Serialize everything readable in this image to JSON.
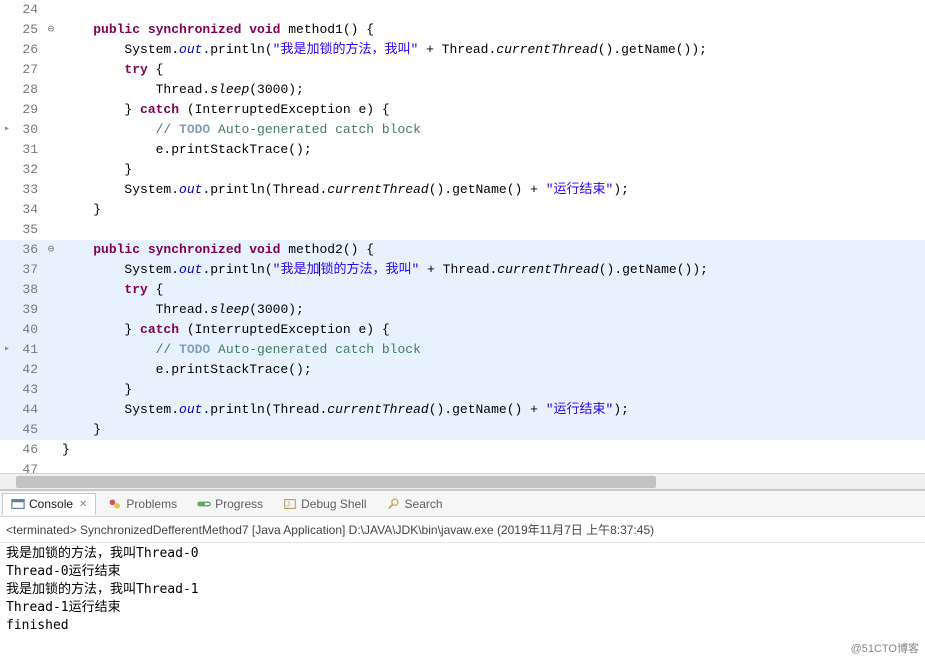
{
  "editor": {
    "lines": [
      {
        "num": 24,
        "anno": "",
        "fold": "",
        "tokens": []
      },
      {
        "num": 25,
        "anno": "",
        "fold": "⊖",
        "tokens": [
          {
            "t": "    ",
            "c": ""
          },
          {
            "t": "public synchronized void",
            "c": "kw"
          },
          {
            "t": " method1() {",
            "c": ""
          }
        ]
      },
      {
        "num": 26,
        "anno": "",
        "fold": "",
        "tokens": [
          {
            "t": "        System.",
            "c": ""
          },
          {
            "t": "out",
            "c": "field"
          },
          {
            "t": ".println(",
            "c": ""
          },
          {
            "t": "\"我是加锁的方法，我叫\"",
            "c": "str"
          },
          {
            "t": " + Thread.",
            "c": ""
          },
          {
            "t": "currentThread",
            "c": "mstatic"
          },
          {
            "t": "().getName());",
            "c": ""
          }
        ]
      },
      {
        "num": 27,
        "anno": "",
        "fold": "",
        "tokens": [
          {
            "t": "        ",
            "c": ""
          },
          {
            "t": "try",
            "c": "kw"
          },
          {
            "t": " {",
            "c": ""
          }
        ]
      },
      {
        "num": 28,
        "anno": "",
        "fold": "",
        "tokens": [
          {
            "t": "            Thread.",
            "c": ""
          },
          {
            "t": "sleep",
            "c": "mstatic"
          },
          {
            "t": "(3000);",
            "c": ""
          }
        ]
      },
      {
        "num": 29,
        "anno": "",
        "fold": "",
        "tokens": [
          {
            "t": "        } ",
            "c": ""
          },
          {
            "t": "catch",
            "c": "kw"
          },
          {
            "t": " (InterruptedException e) {",
            "c": ""
          }
        ]
      },
      {
        "num": 30,
        "anno": "▸",
        "fold": "",
        "tokens": [
          {
            "t": "            ",
            "c": ""
          },
          {
            "t": "// ",
            "c": "comm"
          },
          {
            "t": "TODO",
            "c": "todo"
          },
          {
            "t": " Auto-generated catch block",
            "c": "todo-txt"
          }
        ]
      },
      {
        "num": 31,
        "anno": "",
        "fold": "",
        "tokens": [
          {
            "t": "            e.printStackTrace();",
            "c": ""
          }
        ]
      },
      {
        "num": 32,
        "anno": "",
        "fold": "",
        "tokens": [
          {
            "t": "        }",
            "c": ""
          }
        ]
      },
      {
        "num": 33,
        "anno": "",
        "fold": "",
        "tokens": [
          {
            "t": "        System.",
            "c": ""
          },
          {
            "t": "out",
            "c": "field"
          },
          {
            "t": ".println(Thread.",
            "c": ""
          },
          {
            "t": "currentThread",
            "c": "mstatic"
          },
          {
            "t": "().getName() + ",
            "c": ""
          },
          {
            "t": "\"运行结束\"",
            "c": "str"
          },
          {
            "t": ");",
            "c": ""
          }
        ]
      },
      {
        "num": 34,
        "anno": "",
        "fold": "",
        "tokens": [
          {
            "t": "    }",
            "c": ""
          }
        ]
      },
      {
        "num": 35,
        "anno": "",
        "fold": "",
        "tokens": []
      },
      {
        "num": 36,
        "anno": "",
        "fold": "⊖",
        "hl": true,
        "tokens": [
          {
            "t": "    ",
            "c": ""
          },
          {
            "t": "public synchronized void",
            "c": "kw"
          },
          {
            "t": " method2() {",
            "c": ""
          }
        ]
      },
      {
        "num": 37,
        "anno": "",
        "fold": "",
        "hl": true,
        "cursor": true,
        "tokens": [
          {
            "t": "        System.",
            "c": ""
          },
          {
            "t": "out",
            "c": "field"
          },
          {
            "t": ".println(",
            "c": ""
          },
          {
            "t": "\"我是加",
            "c": "str"
          },
          {
            "t": "|",
            "c": "cursor-marker"
          },
          {
            "t": "锁的方法，我叫\"",
            "c": "str"
          },
          {
            "t": " + Thread.",
            "c": ""
          },
          {
            "t": "currentThread",
            "c": "mstatic"
          },
          {
            "t": "().getName());",
            "c": ""
          }
        ]
      },
      {
        "num": 38,
        "anno": "",
        "fold": "",
        "hl": true,
        "tokens": [
          {
            "t": "        ",
            "c": ""
          },
          {
            "t": "try",
            "c": "kw"
          },
          {
            "t": " {",
            "c": ""
          }
        ]
      },
      {
        "num": 39,
        "anno": "",
        "fold": "",
        "hl": true,
        "tokens": [
          {
            "t": "            Thread.",
            "c": ""
          },
          {
            "t": "sleep",
            "c": "mstatic"
          },
          {
            "t": "(3000);",
            "c": ""
          }
        ]
      },
      {
        "num": 40,
        "anno": "",
        "fold": "",
        "hl": true,
        "tokens": [
          {
            "t": "        } ",
            "c": ""
          },
          {
            "t": "catch",
            "c": "kw"
          },
          {
            "t": " (InterruptedException e) {",
            "c": ""
          }
        ]
      },
      {
        "num": 41,
        "anno": "▸",
        "fold": "",
        "hl": true,
        "tokens": [
          {
            "t": "            ",
            "c": ""
          },
          {
            "t": "// ",
            "c": "comm"
          },
          {
            "t": "TODO",
            "c": "todo"
          },
          {
            "t": " Auto-generated catch block",
            "c": "todo-txt"
          }
        ]
      },
      {
        "num": 42,
        "anno": "",
        "fold": "",
        "hl": true,
        "tokens": [
          {
            "t": "            e.printStackTrace();",
            "c": ""
          }
        ]
      },
      {
        "num": 43,
        "anno": "",
        "fold": "",
        "hl": true,
        "tokens": [
          {
            "t": "        }",
            "c": ""
          }
        ]
      },
      {
        "num": 44,
        "anno": "",
        "fold": "",
        "hl": true,
        "tokens": [
          {
            "t": "        System.",
            "c": ""
          },
          {
            "t": "out",
            "c": "field"
          },
          {
            "t": ".println(Thread.",
            "c": ""
          },
          {
            "t": "currentThread",
            "c": "mstatic"
          },
          {
            "t": "().getName() + ",
            "c": ""
          },
          {
            "t": "\"运行结束\"",
            "c": "str"
          },
          {
            "t": ");",
            "c": ""
          }
        ]
      },
      {
        "num": 45,
        "anno": "",
        "fold": "",
        "hl": true,
        "tokens": [
          {
            "t": "    }",
            "c": ""
          }
        ]
      },
      {
        "num": 46,
        "anno": "",
        "fold": "",
        "tokens": [
          {
            "t": "}",
            "c": ""
          }
        ]
      },
      {
        "num": 47,
        "anno": "",
        "fold": "",
        "tokens": []
      }
    ]
  },
  "tabs": {
    "console": "Console",
    "problems": "Problems",
    "progress": "Progress",
    "debugshell": "Debug Shell",
    "search": "Search"
  },
  "terminated": "<terminated> SynchronizedDefferentMethod7 [Java Application] D:\\JAVA\\JDK\\bin\\javaw.exe (2019年11月7日 上午8:37:45)",
  "console_output": [
    "我是加锁的方法，我叫Thread-0",
    "Thread-0运行结束",
    "我是加锁的方法，我叫Thread-1",
    "Thread-1运行结束",
    "finished"
  ],
  "watermark": "@51CTO博客"
}
